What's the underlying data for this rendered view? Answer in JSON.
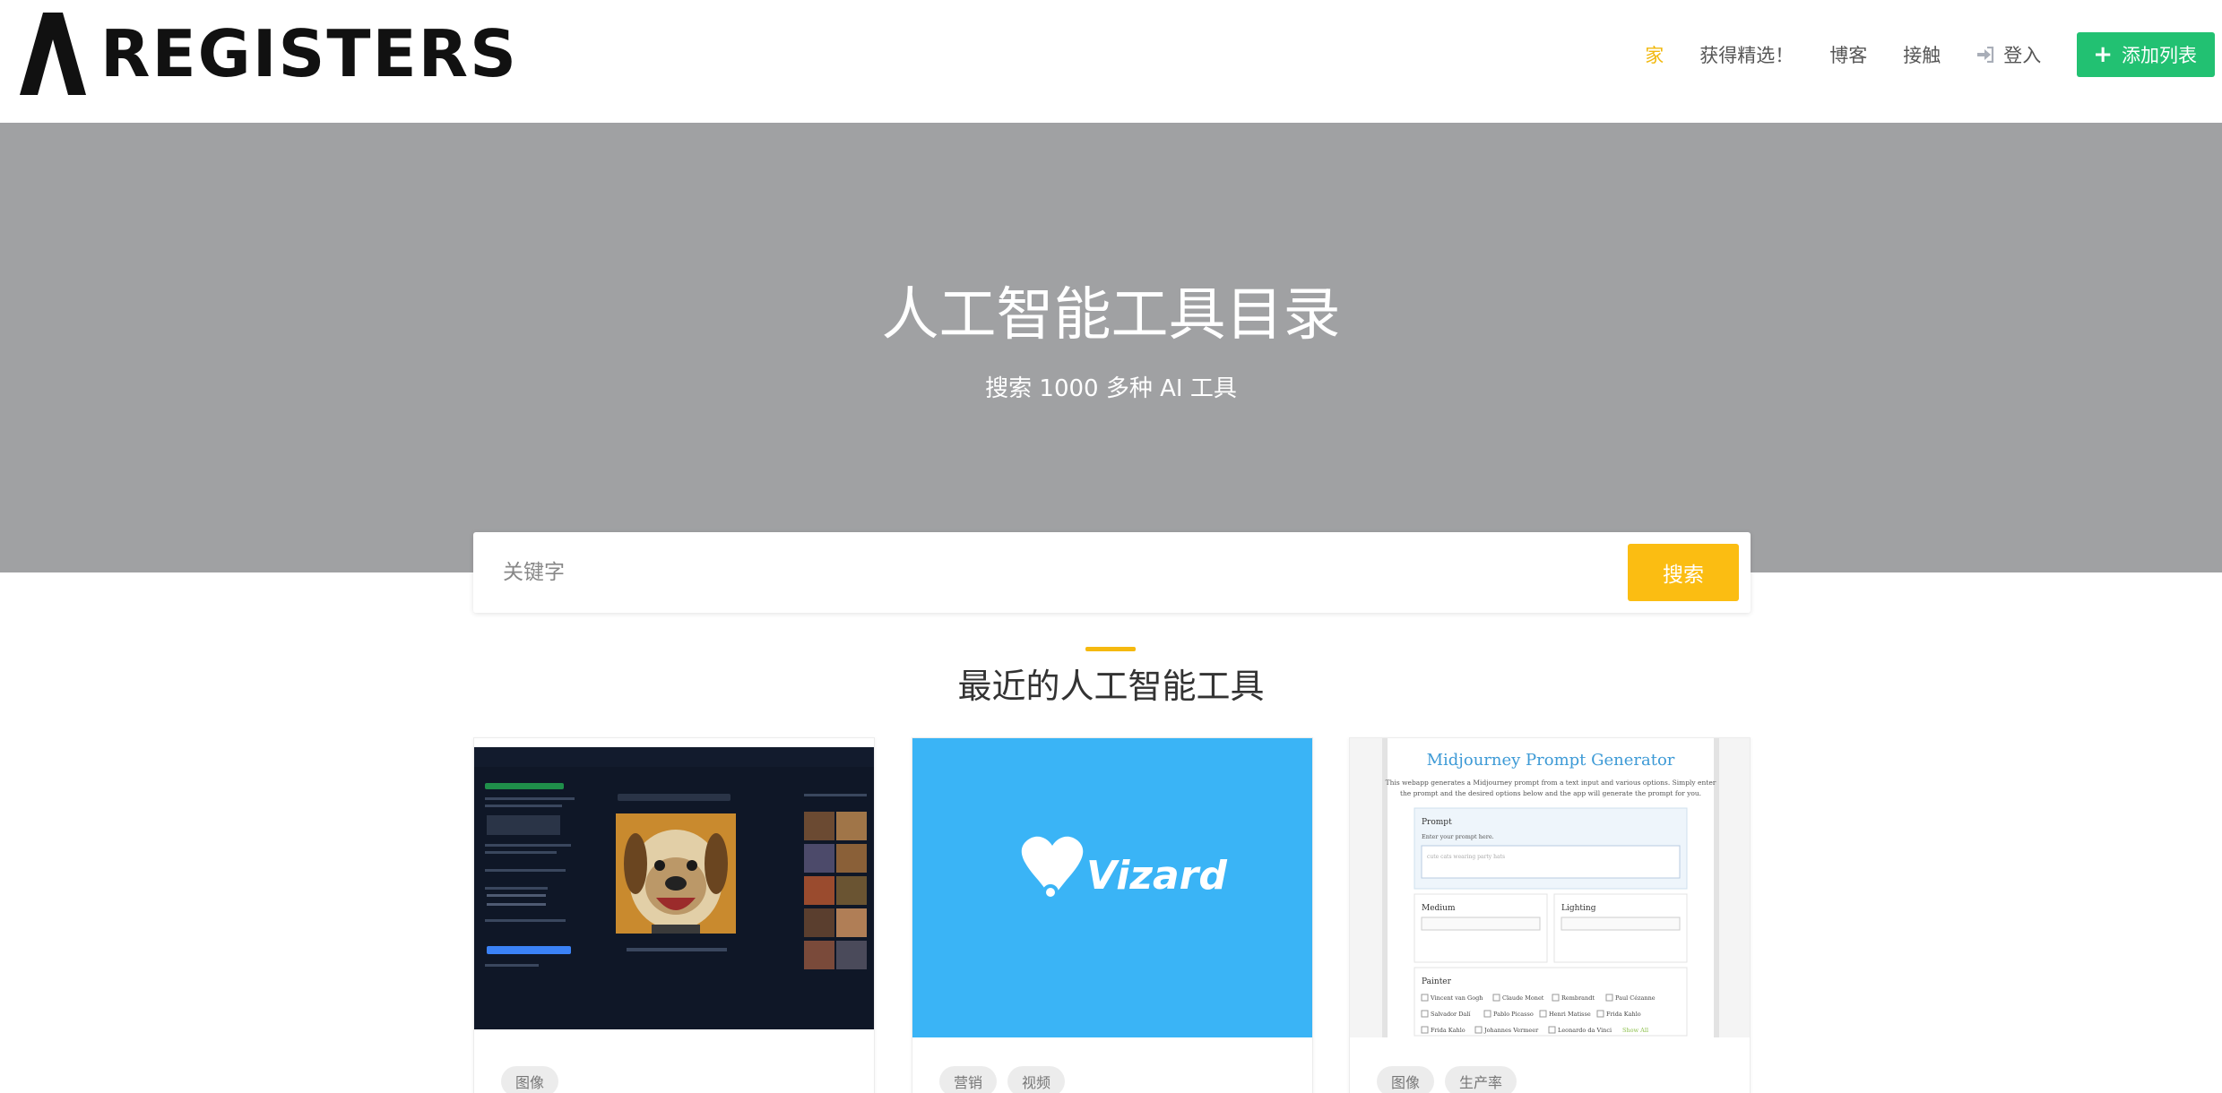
{
  "header": {
    "logo_text": "REGISTERS",
    "nav": {
      "home": "家",
      "featured": "获得精选！",
      "blog": "博客",
      "contact": "接触",
      "login": "登入",
      "add_listing": "添加列表"
    }
  },
  "hero": {
    "title": "人工智能工具目录",
    "subtitle": "搜索 1000 多种 AI 工具"
  },
  "search": {
    "placeholder": "关键字",
    "button": "搜索"
  },
  "section": {
    "title": "最近的人工智能工具"
  },
  "cards": [
    {
      "tags": [
        "图像"
      ]
    },
    {
      "brand": "Vizard",
      "tags": [
        "营销",
        "视频"
      ]
    },
    {
      "tags": [
        "图像",
        "生产率"
      ],
      "screenshot": {
        "title": "Midjourney Prompt Generator",
        "desc_line1": "This webapp generates a Midjourney prompt from a text input and various options. Simply enter",
        "desc_line2": "the prompt and the desired options below and the app will generate the prompt for you.",
        "prompt_label": "Prompt",
        "prompt_hint": "Enter your prompt here.",
        "prompt_placeholder": "cute cats wearing party hats",
        "medium_label": "Medium",
        "lighting_label": "Lighting",
        "painter_label": "Painter",
        "painters": [
          "Vincent van Gogh",
          "Claude Monet",
          "Rembrandt",
          "Paul Cézanne",
          "Salvador Dalí",
          "Pablo Picasso",
          "Henri Matisse",
          "Frida Kahlo",
          "Frida Kahlo",
          "Johannes Vermeer",
          "Leonardo da Vinci"
        ],
        "show_all": "Show All"
      }
    }
  ],
  "colors": {
    "accent_yellow": "#fbbd12",
    "green": "#22c172",
    "hero_gray": "#a0a1a3",
    "vizard_blue": "#3ab4f6"
  }
}
